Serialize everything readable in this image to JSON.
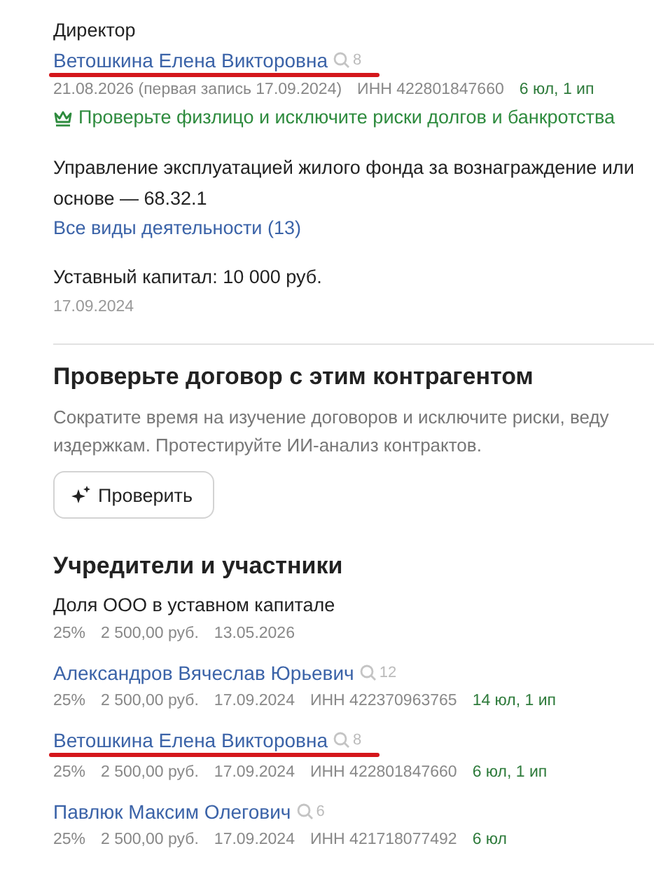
{
  "director": {
    "label": "Директор",
    "person": {
      "name": "Ветошкина Елена Викторовна",
      "mentions": "8",
      "underlined": true
    },
    "meta": [
      "21.08.2026 (первая запись 17.09.2024)",
      "ИНН 422801847660"
    ],
    "links": "6 юл, 1 ип",
    "promo": "Проверьте физлицо и исключите риски долгов и банкротства"
  },
  "activity": {
    "lines": [
      "Управление эксплуатацией жилого фонда за вознаграждение или",
      "основе — 68.32.1"
    ],
    "link": "Все виды деятельности (13)"
  },
  "capital": {
    "text": "Уставный капитал: 10 000 руб.",
    "date": "17.09.2024"
  },
  "contract_check": {
    "title": "Проверьте договор с этим контрагентом",
    "lines": [
      "Сократите время на изучение договоров и исключите риски, веду",
      "издержкам. Протестируйте ИИ-анализ контрактов."
    ],
    "button": "Проверить"
  },
  "founders": {
    "title": "Учредители и участники",
    "items": [
      {
        "kind": "org",
        "name": "Доля ООО в уставном капитале",
        "meta": [
          "25%",
          "2 500,00 руб.",
          "13.05.2026"
        ]
      },
      {
        "kind": "person",
        "name": "Александров Вячеслав Юрьевич",
        "mentions": "12",
        "underlined": false,
        "meta": [
          "25%",
          "2 500,00 руб.",
          "17.09.2024",
          "ИНН 422370963765"
        ],
        "links": "14 юл, 1 ип"
      },
      {
        "kind": "person",
        "name": "Ветошкина Елена Викторовна",
        "mentions": "8",
        "underlined": true,
        "meta": [
          "25%",
          "2 500,00 руб.",
          "17.09.2024",
          "ИНН 422801847660"
        ],
        "links": "6 юл, 1 ип"
      },
      {
        "kind": "person",
        "name": "Павлюк Максим Олегович",
        "mentions": "6",
        "underlined": false,
        "meta": [
          "25%",
          "2 500,00 руб.",
          "17.09.2024",
          "ИНН 421718077492"
        ],
        "links": "6 юл"
      }
    ]
  }
}
